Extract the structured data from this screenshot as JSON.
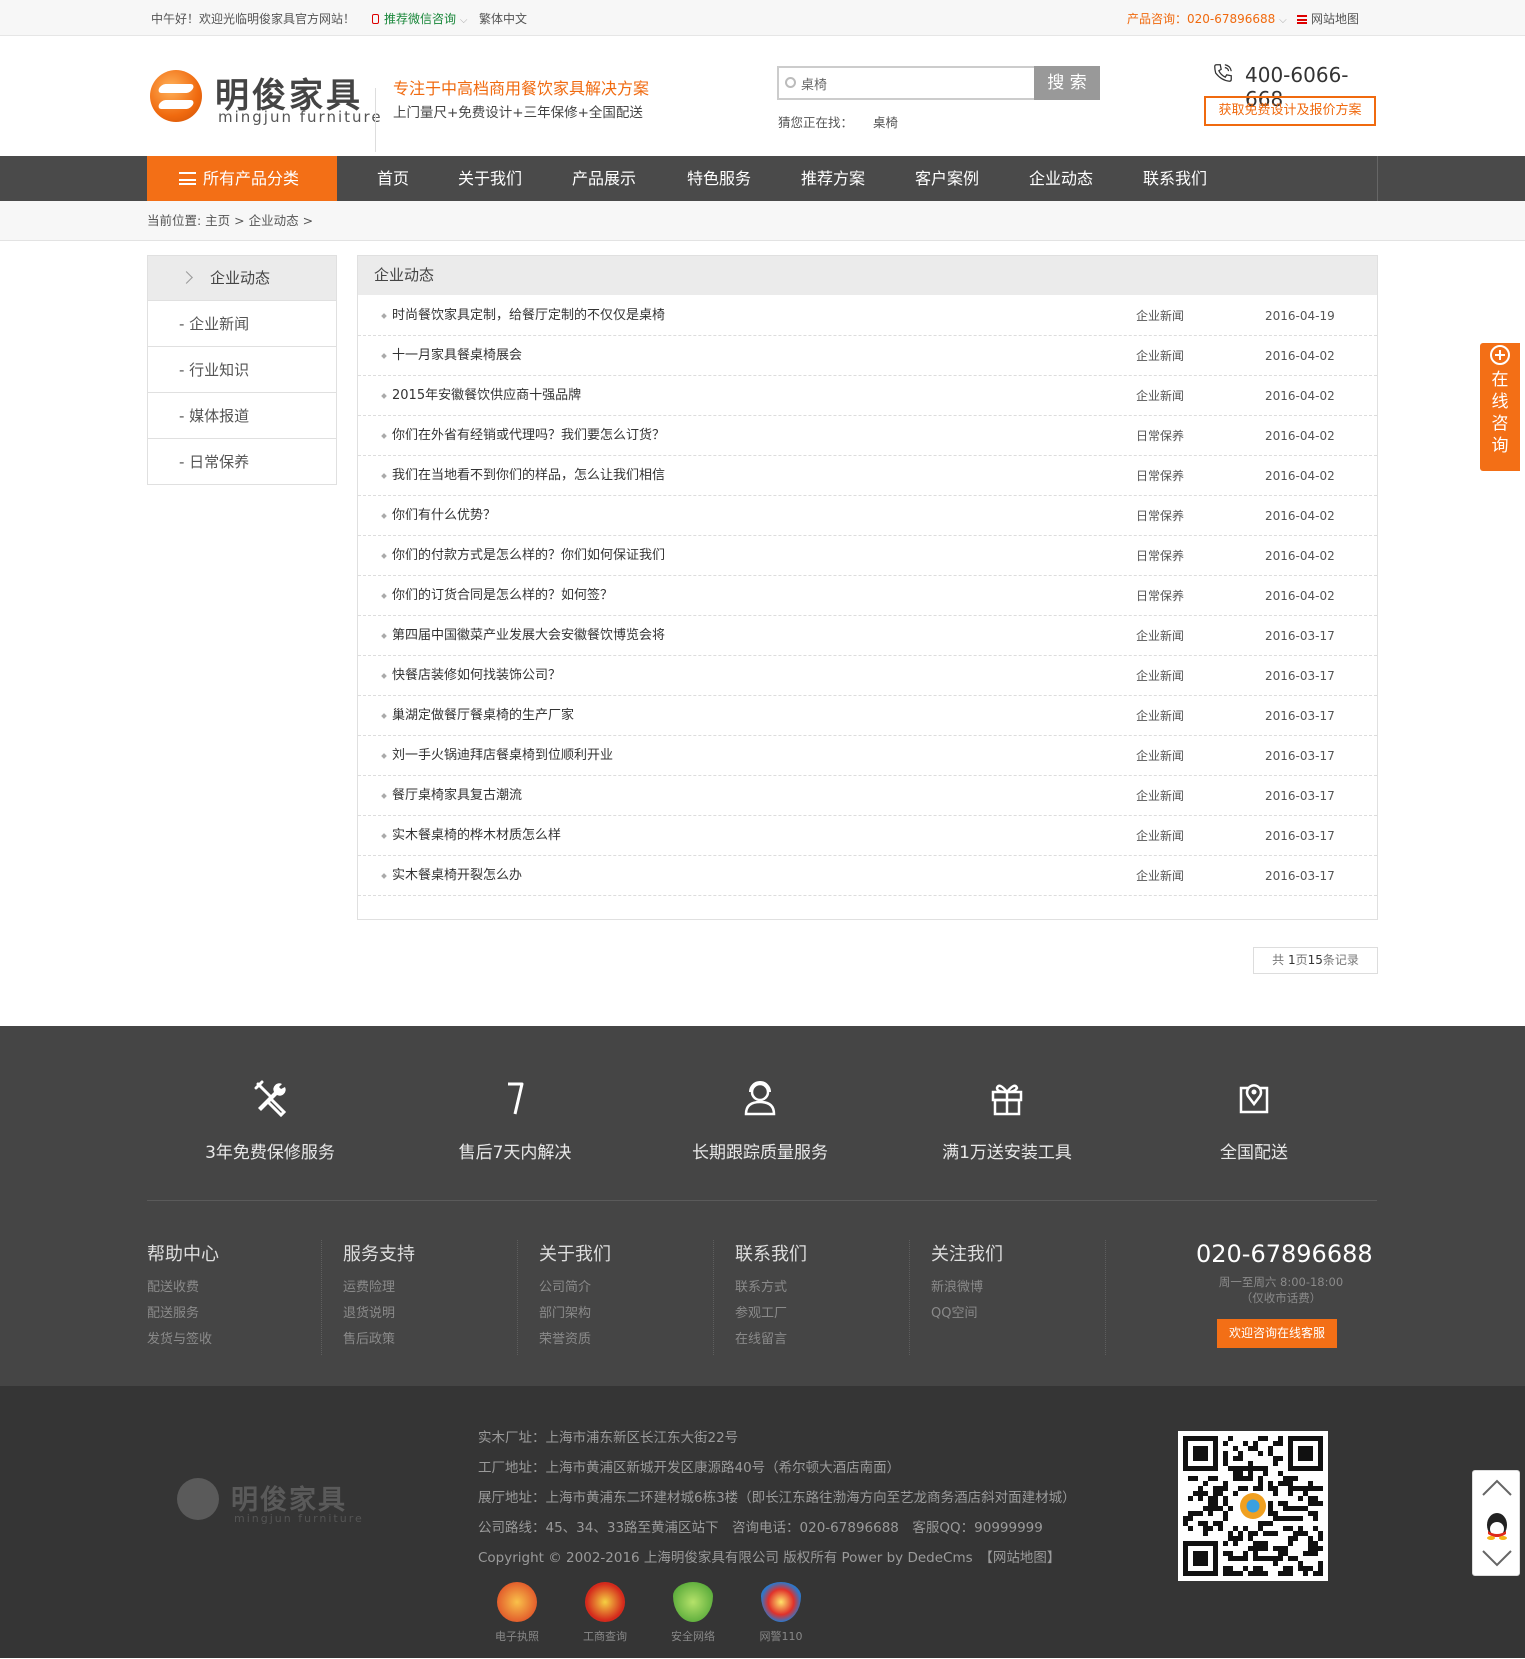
{
  "topbar": {
    "welcome": "中午好！欢迎光临明俊家具官方网站！",
    "wechat": "推荐微信咨询",
    "traditional": "繁体中文",
    "hotline": "产品咨询：020-67896688",
    "sitemap": "网站地图"
  },
  "header": {
    "logo_cn": "明俊家具",
    "logo_en": "mingjun furniture",
    "slogan_main": "专注于中高档商用餐饮家具解决方案",
    "slogan_sub": "上门量尺+免费设计+三年保修+全国配送",
    "search_value": "桌椅",
    "search_button": "搜 索",
    "hot_label": "猜您正在找：",
    "hot_word": "桌椅",
    "phone": "400-6066-668",
    "quote_button": "获取免费设计及报价方案"
  },
  "nav": {
    "all_label": "所有产品分类",
    "items": [
      "首页",
      "关于我们",
      "产品展示",
      "特色服务",
      "推荐方案",
      "客户案例",
      "企业动态",
      "联系我们"
    ]
  },
  "breadcrumb": "当前位置: 主页 > 企业动态 >",
  "sidebar": {
    "title": "企业动态",
    "items": [
      "- 企业新闻",
      "- 行业知识",
      "- 媒体报道",
      "- 日常保养"
    ]
  },
  "content": {
    "title": "企业动态",
    "news": [
      {
        "title": "时尚餐饮家具定制，给餐厅定制的不仅仅是桌椅",
        "category": "企业新闻",
        "date": "2016-04-19"
      },
      {
        "title": "十一月家具餐桌椅展会",
        "category": "企业新闻",
        "date": "2016-04-02"
      },
      {
        "title": "2015年安徽餐饮供应商十强品牌",
        "category": "企业新闻",
        "date": "2016-04-02"
      },
      {
        "title": "你们在外省有经销或代理吗？我们要怎么订货？",
        "category": "日常保养",
        "date": "2016-04-02"
      },
      {
        "title": "我们在当地看不到你们的样品，怎么让我们相信",
        "category": "日常保养",
        "date": "2016-04-02"
      },
      {
        "title": "你们有什么优势？",
        "category": "日常保养",
        "date": "2016-04-02"
      },
      {
        "title": "你们的付款方式是怎么样的？你们如何保证我们",
        "category": "日常保养",
        "date": "2016-04-02"
      },
      {
        "title": "你们的订货合同是怎么样的？如何签？",
        "category": "日常保养",
        "date": "2016-04-02"
      },
      {
        "title": "第四届中国徽菜产业发展大会安徽餐饮博览会将",
        "category": "企业新闻",
        "date": "2016-03-17"
      },
      {
        "title": "快餐店装修如何找装饰公司？",
        "category": "企业新闻",
        "date": "2016-03-17"
      },
      {
        "title": "巢湖定做餐厅餐桌椅的生产厂家",
        "category": "企业新闻",
        "date": "2016-03-17"
      },
      {
        "title": "刘一手火锅迪拜店餐桌椅到位顺利开业",
        "category": "企业新闻",
        "date": "2016-03-17"
      },
      {
        "title": "餐厅桌椅家具复古潮流",
        "category": "企业新闻",
        "date": "2016-03-17"
      },
      {
        "title": "实木餐桌椅的桦木材质怎么样",
        "category": "企业新闻",
        "date": "2016-03-17"
      },
      {
        "title": "实木餐桌椅开裂怎么办",
        "category": "企业新闻",
        "date": "2016-03-17"
      }
    ],
    "pager_pre": "共",
    "pager_pages": "1",
    "pager_mid": "页",
    "pager_count": "15",
    "pager_post": "条记录"
  },
  "services": [
    {
      "icon": "tools-icon",
      "label": "3年免费保修服务"
    },
    {
      "icon": "seven-days-icon",
      "label": "售后7天内解决"
    },
    {
      "icon": "support-agent-icon",
      "label": "长期跟踪质量服务"
    },
    {
      "icon": "gift-icon",
      "label": "满1万送安装工具"
    },
    {
      "icon": "map-pin-icon",
      "label": "全国配送"
    }
  ],
  "footer_cols": [
    {
      "title": "帮助中心",
      "links": [
        "配送收费",
        "配送服务",
        "发货与签收"
      ]
    },
    {
      "title": "服务支持",
      "links": [
        "运费险理",
        "退货说明",
        "售后政策"
      ]
    },
    {
      "title": "关于我们",
      "links": [
        "公司简介",
        "部门架构",
        "荣誉资质"
      ]
    },
    {
      "title": "联系我们",
      "links": [
        "联系方式",
        "参观工厂",
        "在线留言"
      ]
    },
    {
      "title": "关注我们",
      "links": [
        "新浪微博",
        "QQ空间"
      ]
    }
  ],
  "footer_contact": {
    "phone": "020-67896688",
    "hours": "周一至周六 8:00-18:00",
    "hours_note": "（仅收市话费）",
    "online_button": "欢迎咨询在线客服"
  },
  "bottom": {
    "logo_cn": "明俊家具",
    "logo_en": "mingjun furniture",
    "lines": [
      "实木厂址：上海市浦东新区长江东大街22号",
      "工厂地址：上海市黄浦区新城开发区康源路40号（希尔顿大酒店南面）",
      "展厅地址：上海市黄浦东二环建材城6栋3楼（即长江东路往渤海方向至艺龙商务酒店斜对面建材城）",
      "公司路线：45、34、33路至黄浦区站下　咨询电话：020-67896688　客服QQ：90999999",
      "Copyright © 2002-2016 上海明俊家具有限公司 版权所有 Power by DedeCms　【网站地图】"
    ],
    "badges": [
      "电子执照",
      "工商查询",
      "安全网络",
      "网警110"
    ]
  },
  "float": {
    "consult": "在线咨询"
  },
  "colors": {
    "accent": "#f36f16",
    "nav_bg": "#4a4a4a",
    "footer_bg": "#454545",
    "bottom_bg": "#353535"
  }
}
